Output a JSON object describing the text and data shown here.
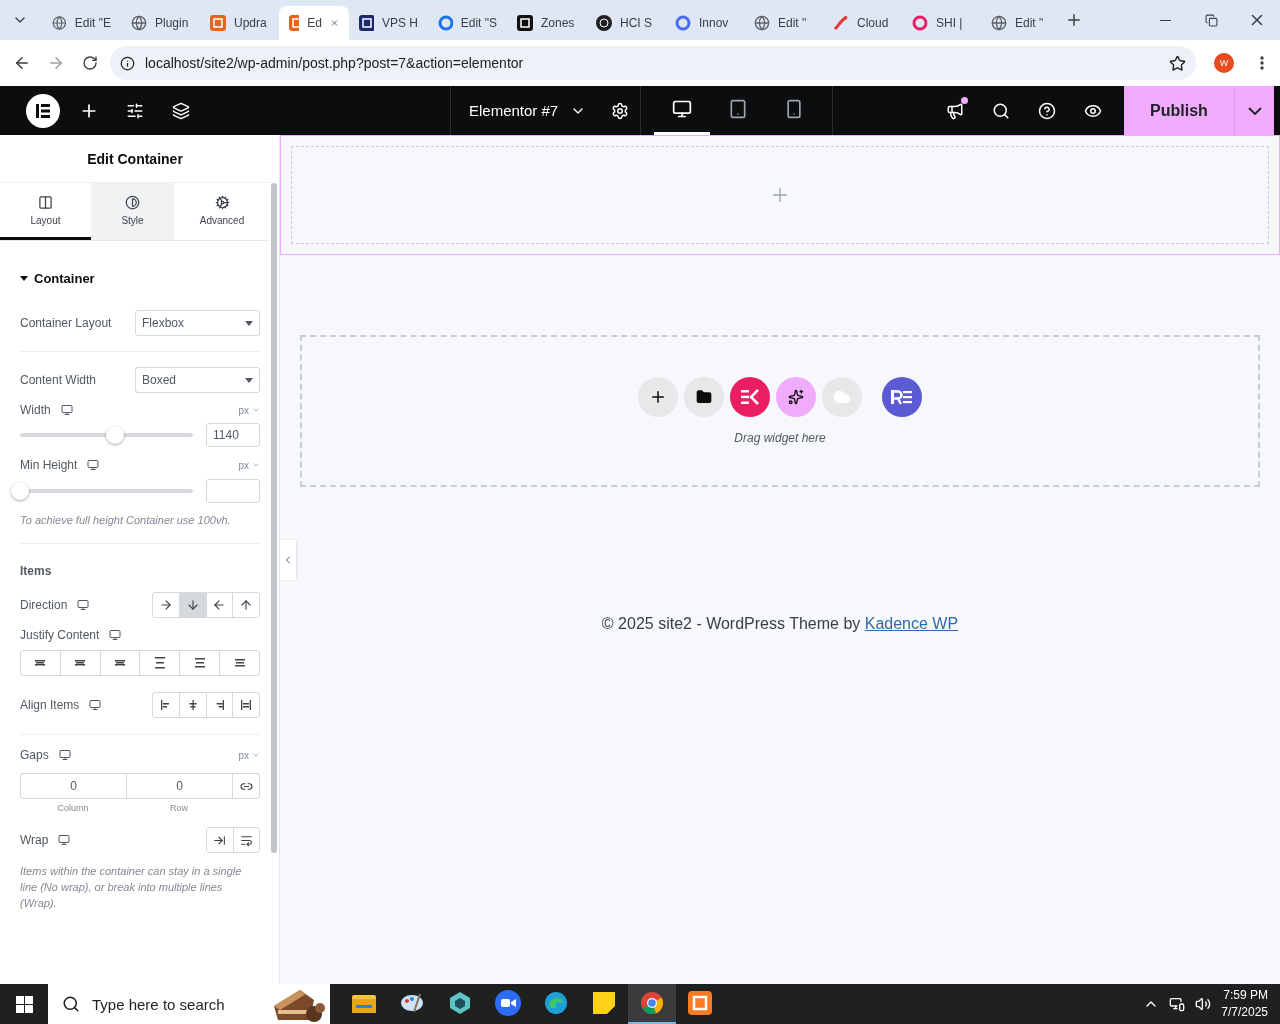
{
  "browser": {
    "tabs": [
      {
        "title": "Edit \"E",
        "selected": false,
        "kind": "globe",
        "color": "#5f6368"
      },
      {
        "title": "Plugin",
        "selected": false,
        "kind": "globe",
        "color": "#5f6368"
      },
      {
        "title": "Updra",
        "selected": false,
        "kind": "tile",
        "color": "#e8641b"
      },
      {
        "title": "Ed",
        "selected": true,
        "kind": "tile",
        "color": "#e8641b"
      },
      {
        "title": "VPS H",
        "selected": false,
        "kind": "tile",
        "color": "#1a2a6c"
      },
      {
        "title": "Edit \"S",
        "selected": false,
        "kind": "ring",
        "color": "#1a73e8"
      },
      {
        "title": "Zones",
        "selected": false,
        "kind": "tile",
        "color": "#111111"
      },
      {
        "title": "HCI S",
        "selected": false,
        "kind": "dot",
        "color": "#202124"
      },
      {
        "title": "Innov",
        "selected": false,
        "kind": "ring",
        "color": "#4a6cf7"
      },
      {
        "title": "Edit \"",
        "selected": false,
        "kind": "globe",
        "color": "#5f6368"
      },
      {
        "title": "Cloud",
        "selected": false,
        "kind": "slash",
        "color": "#e53935"
      },
      {
        "title": "SHI |",
        "selected": false,
        "kind": "ring",
        "color": "#e91e63"
      },
      {
        "title": "Edit \"",
        "selected": false,
        "kind": "globe",
        "color": "#5f6368"
      }
    ],
    "url": "localhost/site2/wp-admin/post.php?post=7&action=elementor",
    "profile": "W"
  },
  "topbar": {
    "document_title": "Elementor #7",
    "devices": [
      {
        "kind": "desktop",
        "selected": true
      },
      {
        "kind": "tablet",
        "selected": false
      },
      {
        "kind": "mobile",
        "selected": false
      }
    ],
    "publish": "Publish",
    "notification": true
  },
  "panel": {
    "title": "Edit Container",
    "tabs": [
      {
        "label": "Layout",
        "kind": "layout",
        "selected": true
      },
      {
        "label": "Style",
        "kind": "style",
        "selected": false
      },
      {
        "label": "Advanced",
        "kind": "advanced",
        "selected": false
      }
    ],
    "section": {
      "title": "Container",
      "expanded": true
    },
    "container_layout": {
      "label": "Container Layout",
      "value": "Flexbox"
    },
    "content_width": {
      "label": "Content Width",
      "value": "Boxed"
    },
    "width": {
      "label": "Width",
      "unit": "px",
      "value": "1140",
      "level": 0.58
    },
    "min_height": {
      "label": "Min Height",
      "unit": "px",
      "level": 0
    },
    "min_height_note": "To achieve full height Container use 100vh.",
    "items_heading": "Items",
    "direction": {
      "label": "Direction",
      "options": [
        {
          "kind": "right",
          "selected": false
        },
        {
          "kind": "down",
          "selected": true
        },
        {
          "kind": "left",
          "selected": false
        },
        {
          "kind": "up",
          "selected": false
        }
      ]
    },
    "justify_content": {
      "label": "Justify Content",
      "options": [
        {
          "kind": "start",
          "selected": false
        },
        {
          "kind": "center",
          "selected": false
        },
        {
          "kind": "end",
          "selected": false
        },
        {
          "kind": "between",
          "selected": false
        },
        {
          "kind": "around",
          "selected": false
        },
        {
          "kind": "evenly",
          "selected": false
        }
      ]
    },
    "align_items": {
      "label": "Align Items",
      "options": [
        {
          "kind": "start",
          "selected": false
        },
        {
          "kind": "center",
          "selected": false
        },
        {
          "kind": "end",
          "selected": false
        },
        {
          "kind": "stretch",
          "selected": false
        }
      ]
    },
    "gaps": {
      "label": "Gaps",
      "unit": "px",
      "column": "0",
      "row": "0",
      "column_label": "Column",
      "row_label": "Row"
    },
    "wrap": {
      "label": "Wrap",
      "options": [
        {
          "kind": "nowrap",
          "selected": false
        },
        {
          "kind": "wrap",
          "selected": false
        }
      ]
    },
    "wrap_note": "Items within the container can stay in a single line (No wrap), or break into multiple lines (Wrap)."
  },
  "canvas": {
    "drop_hint": "Drag widget here",
    "footer": "© 2025 site2 - WordPress Theme by",
    "footer_link": "Kadence WP"
  },
  "taskbar": {
    "search_placeholder": "Type here to search",
    "time": "7:59 PM",
    "date": "7/7/2025",
    "apps": [
      {
        "kind": "folder",
        "selected": false
      },
      {
        "kind": "paint",
        "selected": false
      },
      {
        "kind": "cube",
        "selected": false
      },
      {
        "kind": "zoom",
        "selected": false
      },
      {
        "kind": "edge",
        "selected": false
      },
      {
        "kind": "note",
        "selected": false
      },
      {
        "kind": "chrome",
        "selected": true
      },
      {
        "kind": "xampp",
        "selected": false
      }
    ]
  }
}
